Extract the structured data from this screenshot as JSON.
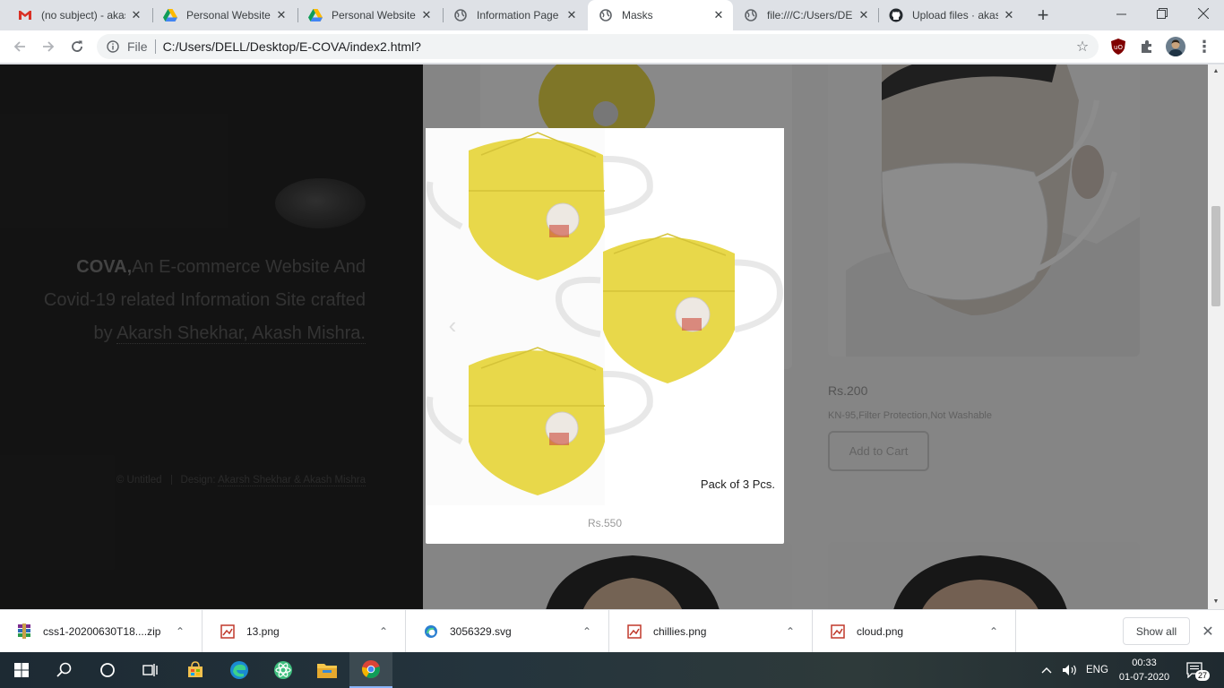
{
  "browser": {
    "tabs": [
      {
        "title": "(no subject) - akas",
        "favicon": "gmail-icon",
        "active": false
      },
      {
        "title": "Personal Website",
        "favicon": "google-drive-icon",
        "active": false
      },
      {
        "title": "Personal Website",
        "favicon": "google-drive-icon",
        "active": false
      },
      {
        "title": "Information Page",
        "favicon": "globe-icon",
        "active": false
      },
      {
        "title": "Masks",
        "favicon": "globe-icon",
        "active": true
      },
      {
        "title": "file:///C:/Users/DE",
        "favicon": "globe-icon",
        "active": false
      },
      {
        "title": "Upload files · akas",
        "favicon": "github-icon",
        "active": false
      }
    ],
    "address": {
      "scheme_label": "File",
      "url": "C:/Users/DELL/Desktop/E-COVA/index2.html?"
    }
  },
  "page": {
    "sidebar": {
      "brand": "COVA,",
      "tagline_part1": "An E-commerce Website And Covid-19 related Information Site crafted by",
      "author_link": "Akarsh Shekhar, Akash Mishra.",
      "footer_copyright": "© Untitled",
      "footer_design_label": "Design:",
      "footer_design_link": "Akarsh Shekhar & Akash Mishra"
    },
    "product": {
      "price": "Rs.200",
      "description": "KN-95,Filter Protection,Not Washable",
      "cart_button": "Add to Cart"
    },
    "modal": {
      "caption": "Pack of 3 Pcs.",
      "price": "Rs.550"
    }
  },
  "downloads": {
    "items": [
      {
        "name": "css1-20200630T18....zip",
        "icon": "winrar-icon"
      },
      {
        "name": "13.png",
        "icon": "image-file-icon"
      },
      {
        "name": "3056329.svg",
        "icon": "edge-file-icon"
      },
      {
        "name": "chillies.png",
        "icon": "image-file-icon"
      },
      {
        "name": "cloud.png",
        "icon": "image-file-icon"
      }
    ],
    "show_all": "Show all"
  },
  "taskbar": {
    "language": "ENG",
    "time": "00:33",
    "date": "01-07-2020",
    "notification_count": "27"
  },
  "colors": {
    "accent": "#1a73e8",
    "mask_yellow": "#e8d84a",
    "sidebar_bg": "#242424"
  }
}
